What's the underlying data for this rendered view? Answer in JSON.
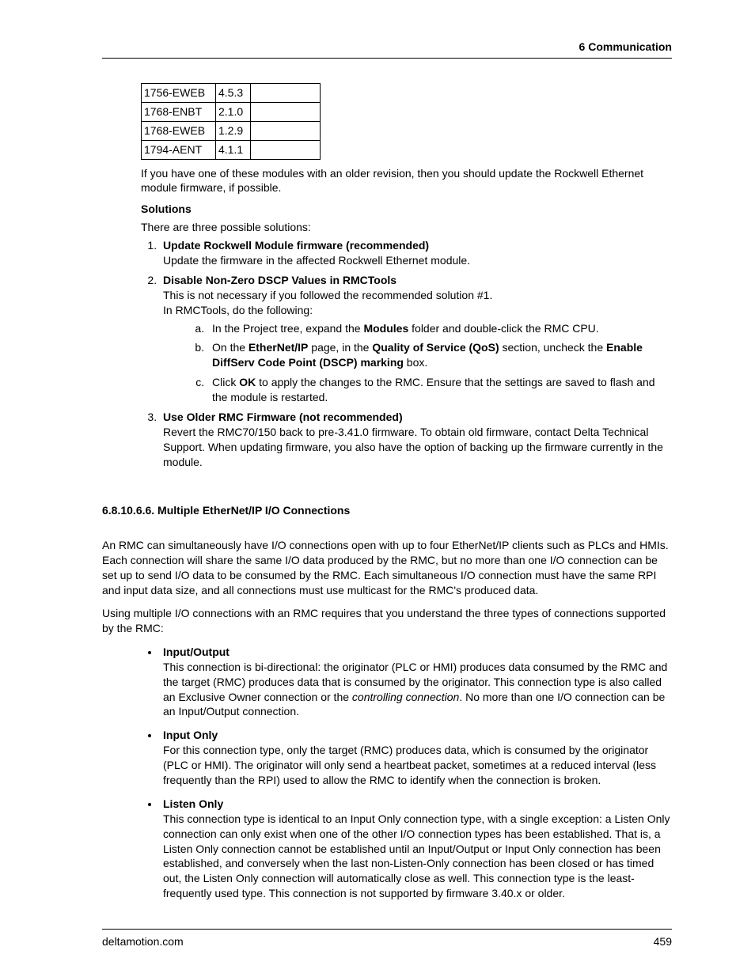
{
  "header": {
    "section": "6  Communication"
  },
  "module_table": [
    {
      "name": "1756-EWEB",
      "rev": "4.5.3",
      "note": ""
    },
    {
      "name": "1768-ENBT",
      "rev": "2.1.0",
      "note": ""
    },
    {
      "name": "1768-EWEB",
      "rev": "1.2.9",
      "note": ""
    },
    {
      "name": "1794-AENT",
      "rev": "4.1.1",
      "note": ""
    }
  ],
  "after_table_para": "If you have one of these modules with an older revision, then you should update the Rockwell Ethernet module firmware, if possible.",
  "solutions_heading": "Solutions",
  "solutions_intro": "There are three possible solutions:",
  "solutions": [
    {
      "title": "Update Rockwell Module firmware (recommended)",
      "body": "Update the firmware in the affected Rockwell Ethernet module."
    },
    {
      "title": "Disable Non-Zero DSCP Values in RMCTools",
      "body_line1": "This is not necessary if you followed the recommended solution #1.",
      "body_line2": "In RMCTools, do the following:",
      "sub": {
        "a_pre": "In the Project tree, expand the ",
        "a_bold": "Modules",
        "a_post": " folder and double-click the RMC CPU.",
        "b_pre": "On the ",
        "b_b1": "EtherNet/IP",
        "b_mid1": " page, in the ",
        "b_b2": "Quality of Service (QoS)",
        "b_mid2": " section, uncheck the ",
        "b_b3": "Enable DiffServ Code Point (DSCP) marking",
        "b_post": " box.",
        "c_pre": "Click ",
        "c_bold": "OK",
        "c_post": " to apply the changes to the RMC. Ensure that the settings are saved to flash and the module is restarted."
      }
    },
    {
      "title": "Use Older RMC Firmware (not recommended)",
      "body": "Revert the RMC70/150 back to pre-3.41.0 firmware. To obtain old firmware, contact Delta Technical Support. When updating firmware, you also have the option of backing up the firmware currently in the module."
    }
  ],
  "section2": {
    "number_title": "6.8.10.6.6. Multiple EtherNet/IP I/O Connections",
    "p1": "An RMC can simultaneously have I/O connections open with up to four EtherNet/IP clients such as PLCs and HMIs. Each connection will share the same I/O data produced by the RMC, but no more than one I/O connection can be set up to send I/O data to be consumed by the RMC. Each simultaneous I/O connection must have the same RPI and input data size, and all connections must use multicast for the RMC's produced data.",
    "p2": "Using multiple I/O connections with an RMC requires that you understand the three types of connections supported by the RMC:",
    "conn": [
      {
        "title": "Input/Output",
        "body_pre": "This connection is bi-directional: the originator (PLC or HMI) produces data consumed by the RMC and the target (RMC) produces data that is consumed by the originator. This connection type is also called an Exclusive Owner connection or the ",
        "body_italic": "controlling connection",
        "body_post": ". No more than one I/O connection can be an Input/Output connection."
      },
      {
        "title": "Input Only",
        "body": "For this connection type, only the target (RMC) produces data, which is consumed by the originator (PLC or HMI). The originator will only send a heartbeat packet, sometimes at a reduced interval (less frequently than the RPI) used to allow the RMC to identify when the connection is broken."
      },
      {
        "title": "Listen Only",
        "body": "This connection type is identical to an Input Only connection type, with a single exception: a Listen Only connection can only exist when one of the other I/O connection types has been established. That is, a Listen Only connection cannot be established until an Input/Output or Input Only connection has been established, and conversely when the last non-Listen-Only connection has been closed or has timed out, the Listen Only connection will automatically close as well. This connection type is the least-frequently used type. This connection is not supported by firmware 3.40.x or older."
      }
    ]
  },
  "footer": {
    "site": "deltamotion.com",
    "page": "459"
  }
}
